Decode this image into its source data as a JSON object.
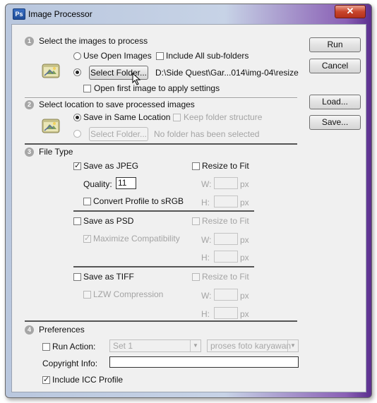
{
  "window": {
    "title": "Image Processor",
    "close_glyph": "✕",
    "app_icon": "Ps"
  },
  "section1": {
    "number": "1",
    "heading": "Select the images to process",
    "use_open_images": "Use Open Images",
    "include_subfolders": "Include All sub-folders",
    "select_folder_button": "Select Folder...",
    "folder_path": "D:\\Side Quest\\Gar...014\\img-04\\resize",
    "open_first_image": "Open first image to apply settings"
  },
  "section2": {
    "number": "2",
    "heading": "Select location to save processed images",
    "save_same_location": "Save in Same Location",
    "keep_folder_structure": "Keep folder structure",
    "select_folder_button": "Select Folder...",
    "no_folder_text": "No folder has been selected"
  },
  "section3": {
    "number": "3",
    "heading": "File Type",
    "jpeg": {
      "label": "Save as JPEG",
      "resize": "Resize to Fit",
      "quality_label": "Quality:",
      "quality_value": "11",
      "convert_profile": "Convert Profile to sRGB",
      "w_label": "W:",
      "h_label": "H:",
      "unit": "px"
    },
    "psd": {
      "label": "Save as PSD",
      "resize": "Resize to Fit",
      "maximize": "Maximize Compatibility",
      "w_label": "W:",
      "h_label": "H:",
      "unit": "px"
    },
    "tiff": {
      "label": "Save as TIFF",
      "resize": "Resize to Fit",
      "lzw": "LZW Compression",
      "w_label": "W:",
      "h_label": "H:",
      "unit": "px"
    }
  },
  "section4": {
    "number": "4",
    "heading": "Preferences",
    "run_action": "Run Action:",
    "action_set": "Set 1",
    "action_name": "proses foto karyawan",
    "copyright_label": "Copyright Info:",
    "copyright_value": "",
    "include_icc": "Include ICC Profile"
  },
  "buttons": {
    "run": "Run",
    "cancel": "Cancel",
    "load": "Load...",
    "save": "Save..."
  },
  "checkmark": "✓"
}
